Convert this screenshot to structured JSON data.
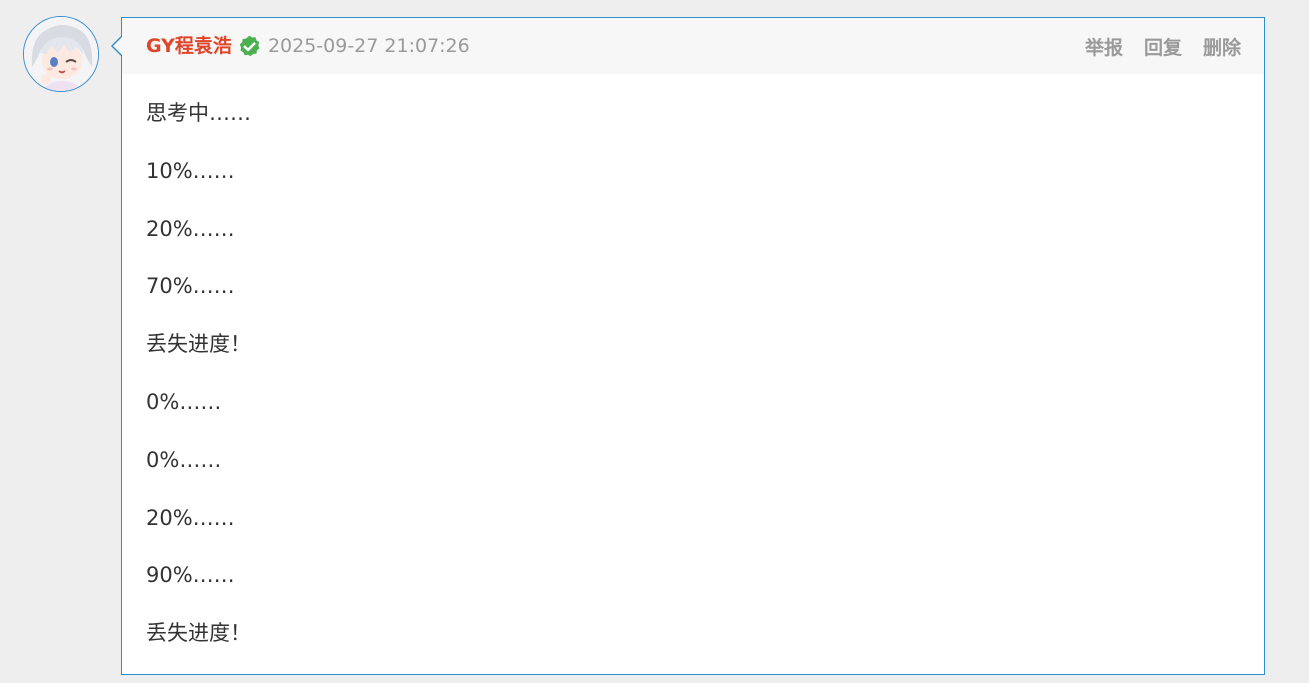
{
  "comment": {
    "author": "GY程袁浩",
    "timestamp": "2025-09-27 21:07:26",
    "actions": {
      "report": "举报",
      "reply": "回复",
      "delete": "删除"
    },
    "lines": [
      "思考中……",
      "10%……",
      "20%……",
      "70%……",
      "丢失进度！",
      "0%……",
      "0%……",
      "20%……",
      "90%……",
      "丢失进度！"
    ]
  },
  "icons": {
    "verified": "verified-check-icon"
  },
  "colors": {
    "author": "#e0452a",
    "verified_badge": "#4caf50",
    "card_border": "#2c8fc9",
    "muted_text": "#9a9a9a",
    "body_text": "#333333",
    "page_background": "#eeeeee"
  }
}
